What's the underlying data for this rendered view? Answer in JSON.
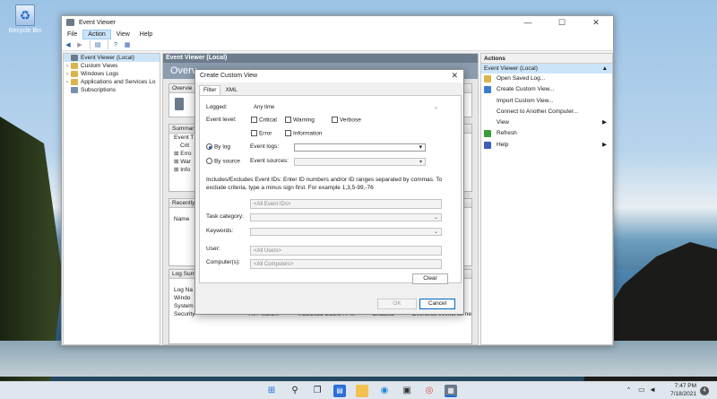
{
  "desktop": {
    "recycle_label": "Recycle Bin"
  },
  "window": {
    "title": "Event Viewer",
    "controls": {
      "minimize": "—",
      "maximize": "☐",
      "close": "✕"
    }
  },
  "menu": [
    "File",
    "Action",
    "View",
    "Help"
  ],
  "tree": {
    "items": [
      {
        "label": "Event Viewer (Local)",
        "selected": true
      },
      {
        "label": "Custom Views"
      },
      {
        "label": "Windows Logs"
      },
      {
        "label": "Applications and Services Lo"
      },
      {
        "label": "Subscriptions"
      }
    ]
  },
  "center": {
    "header": "Event Viewer (Local)",
    "banner": "Overv",
    "overview_label": "Overvie",
    "summary_label": "Summar",
    "summary_lines": [
      "Event T",
      "Crit",
      "⊞ Erro",
      "⊞ War",
      "⊞ Info"
    ],
    "recent_label": "Recently",
    "recent_line": "Name",
    "logsum_label": "Log Sum",
    "logsum_lines": [
      "Log Na",
      "Windo",
      "System",
      "Security"
    ],
    "security_row": {
      "size": "7.07 MB/2...",
      "modified": "7/18/2021 1:23:34 PM",
      "enabled": "Enabled",
      "policy": "Overwrite events as ne"
    }
  },
  "actions": {
    "header": "Actions",
    "subheader": "Event Viewer (Local)",
    "items": [
      {
        "label": "Open Saved Log...",
        "icon": "folder-icon",
        "color": "#d9b54a"
      },
      {
        "label": "Create Custom View...",
        "icon": "filter-icon",
        "color": "#3c7bd0"
      },
      {
        "label": "Import Custom View..."
      },
      {
        "label": "Connect to Another Computer..."
      },
      {
        "label": "View",
        "arrow": "▶"
      },
      {
        "label": "Refresh",
        "icon": "refresh-icon",
        "color": "#3a9a3a"
      },
      {
        "label": "Help",
        "icon": "help-icon",
        "color": "#3c5fb8",
        "arrow": "▶"
      }
    ]
  },
  "dialog": {
    "title": "Create Custom View",
    "tabs": [
      "Filter",
      "XML"
    ],
    "logged_label": "Logged:",
    "logged_value": "Any time",
    "event_level_label": "Event level:",
    "levels": [
      "Critical",
      "Warning",
      "Verbose",
      "Error",
      "Information"
    ],
    "by_log": "By log",
    "by_source": "By source",
    "event_logs_label": "Event logs:",
    "event_sources_label": "Event sources:",
    "ids_text": "Includes/Excludes Event IDs: Enter ID numbers and/or ID ranges separated by commas. To exclude criteria, type a minus sign first. For example 1,3,5-99,-76",
    "ids_placeholder": "<All Event IDs>",
    "task_category_label": "Task category:",
    "keywords_label": "Keywords:",
    "user_label": "User:",
    "user_placeholder": "<All Users>",
    "computers_label": "Computer(s):",
    "computers_placeholder": "<All Computers>",
    "clear": "Clear",
    "ok": "OK",
    "cancel": "Cancel"
  },
  "taskbar": {
    "time": "7:47 PM",
    "date": "7/18/2021",
    "notifications": "4",
    "tray_arrow": "^"
  }
}
